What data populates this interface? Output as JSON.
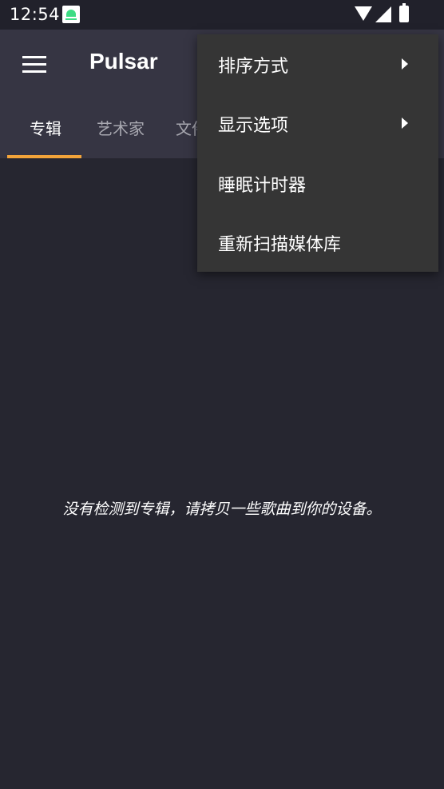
{
  "status_bar": {
    "time": "12:54",
    "icons": [
      "app-notification-icon",
      "wifi-icon",
      "cell-signal-icon",
      "battery-charging-icon"
    ]
  },
  "app_bar": {
    "title": "Pulsar",
    "menu_icon": "hamburger-menu-icon",
    "tabs": [
      {
        "label": "专辑",
        "active": true
      },
      {
        "label": "艺术家",
        "active": false
      },
      {
        "label": "文件",
        "active": false
      }
    ]
  },
  "main": {
    "empty_message": "没有检测到专辑，请拷贝一些歌曲到你的设备。"
  },
  "popup_menu": {
    "items": [
      {
        "label": "排序方式",
        "has_submenu": true
      },
      {
        "label": "显示选项",
        "has_submenu": true
      },
      {
        "label": "睡眠计时器",
        "has_submenu": false
      },
      {
        "label": "重新扫描媒体库",
        "has_submenu": false
      }
    ]
  },
  "colors": {
    "background": "#262630",
    "app_bar": "#363543",
    "accent": "#f3a43a",
    "popup": "#353535"
  }
}
